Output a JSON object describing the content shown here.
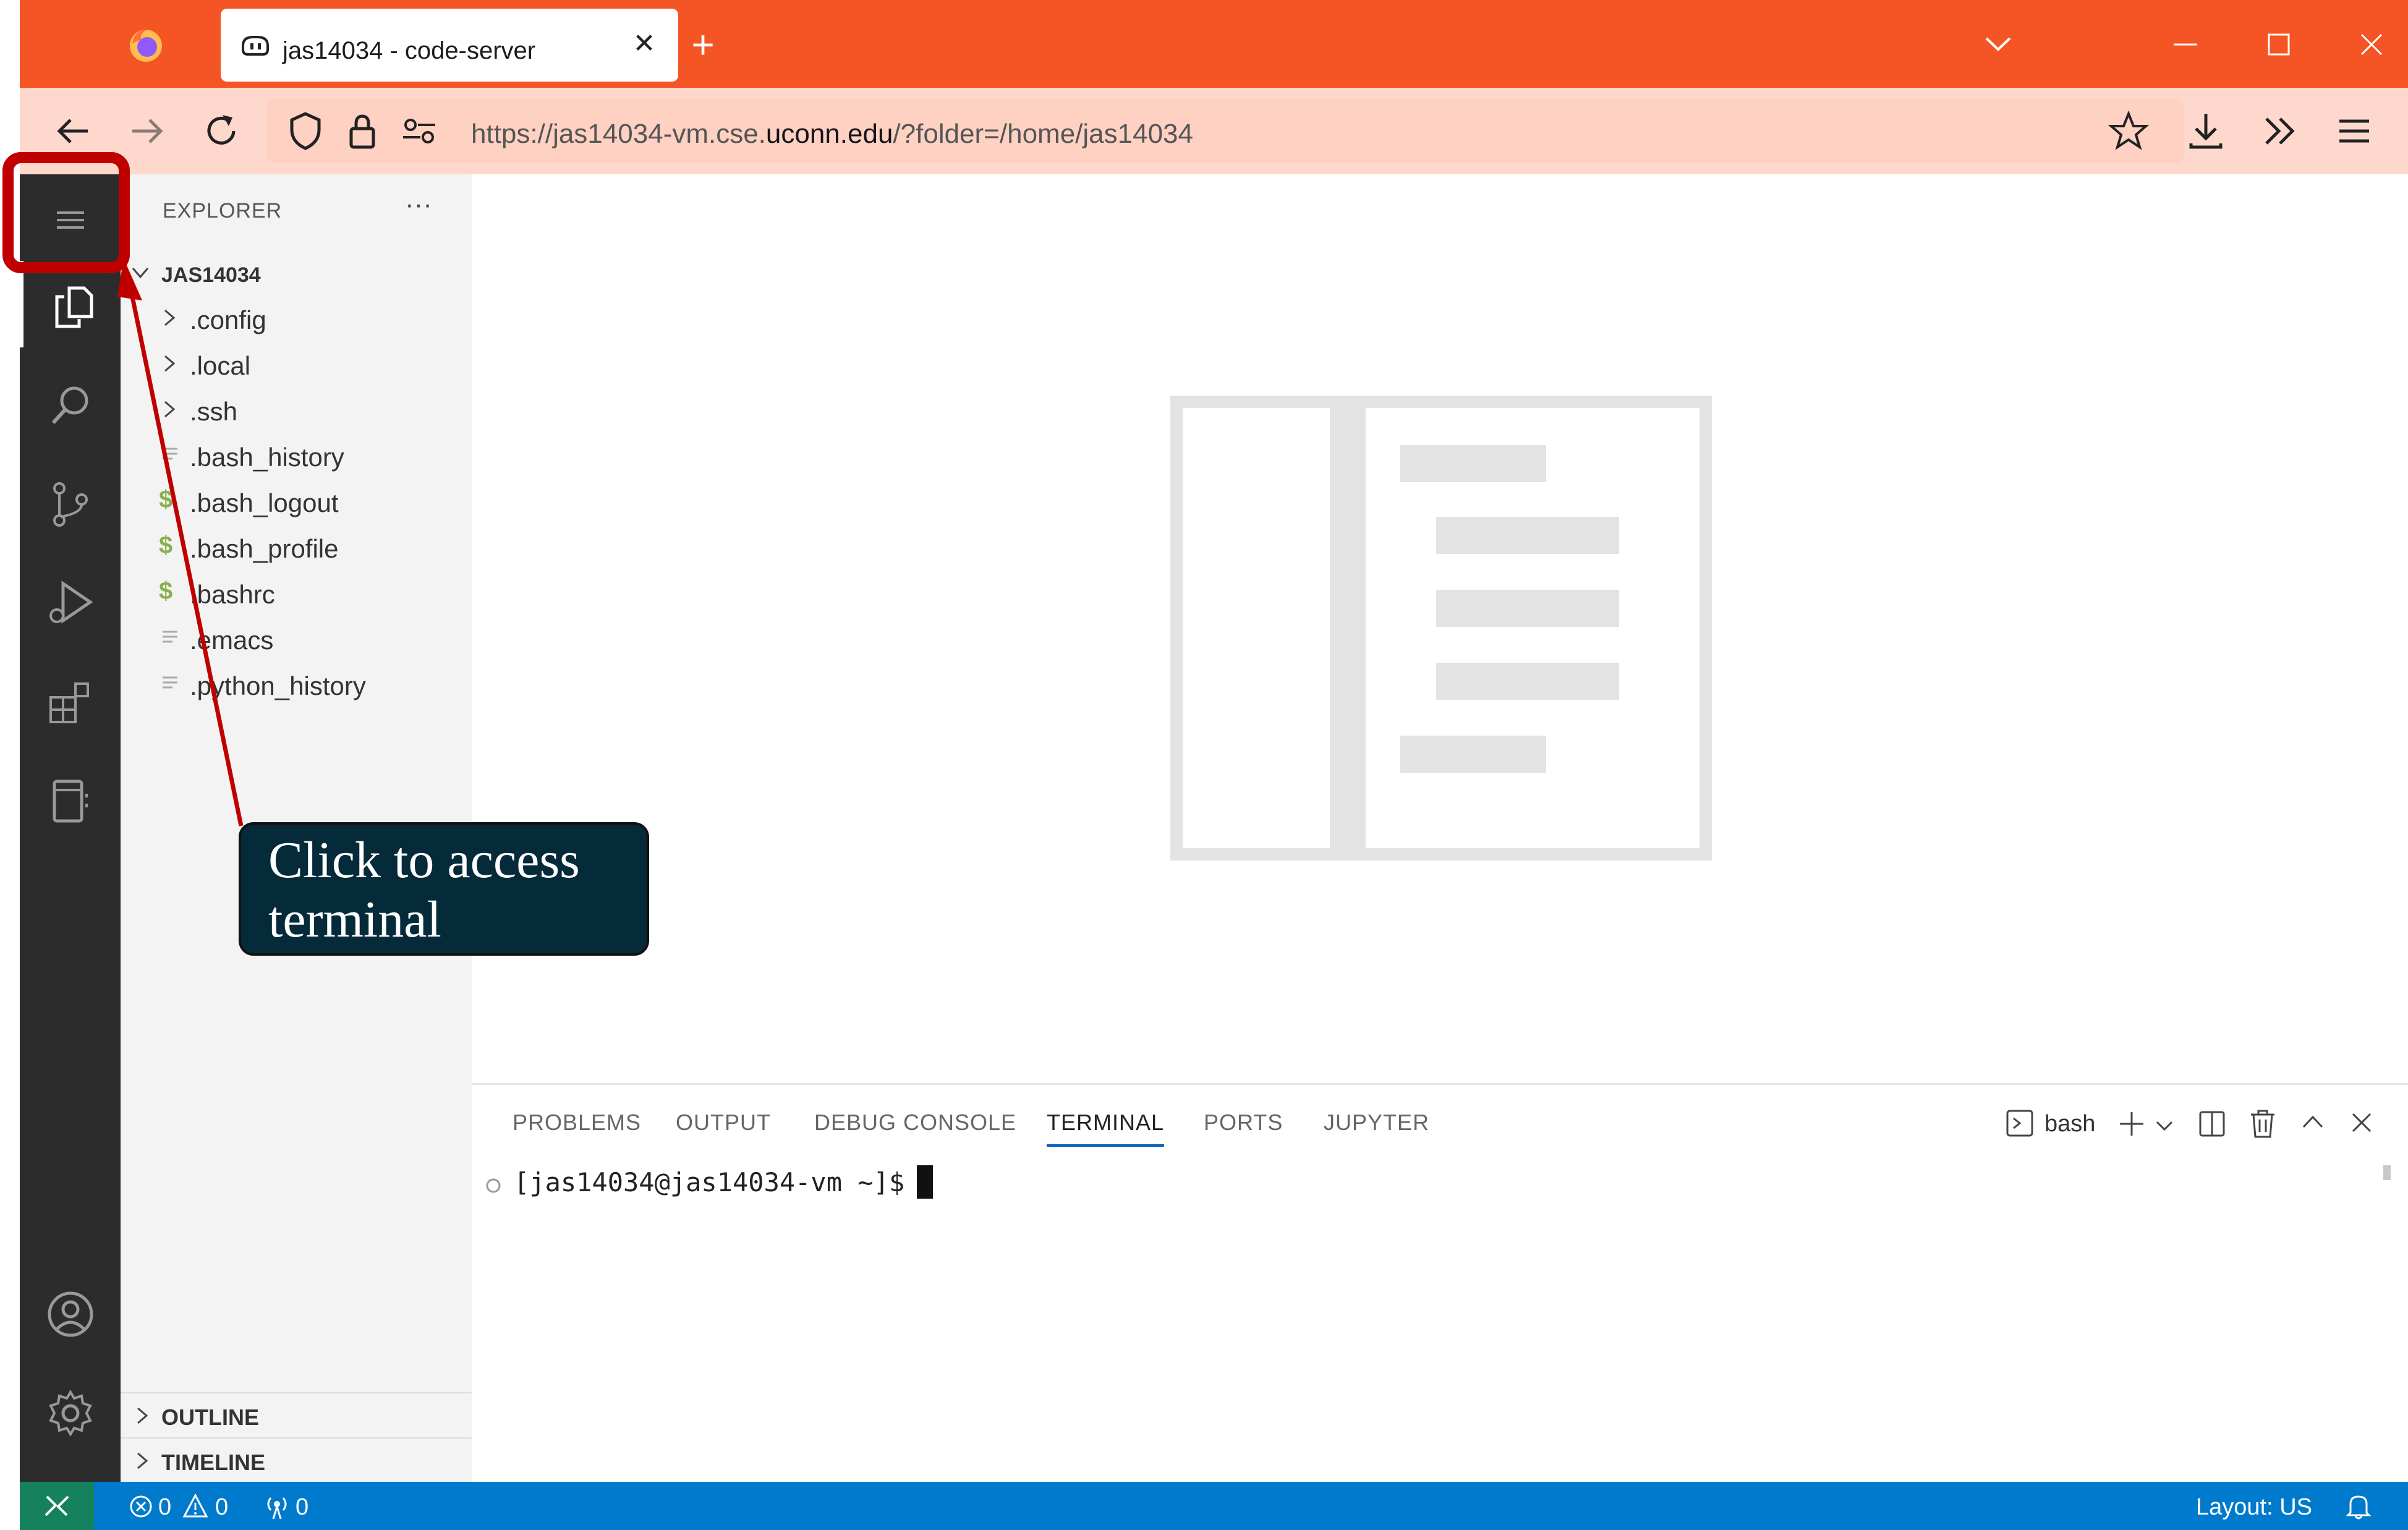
{
  "browser": {
    "tab_title": "jas14034 - code-server",
    "tab_close": "✕",
    "new_tab": "+",
    "url_prefix": "https://jas14034-vm.cse.",
    "url_domain": "uconn.edu",
    "url_suffix": "/?folder=/home/jas14034",
    "accent_color": "#f55424"
  },
  "sidebar": {
    "header": "EXPLORER",
    "more": "···",
    "root_folder": "JAS14034",
    "items": [
      {
        "label": ".config",
        "kind": "folder"
      },
      {
        "label": ".local",
        "kind": "folder"
      },
      {
        "label": ".ssh",
        "kind": "folder"
      },
      {
        "label": ".bash_history",
        "kind": "text"
      },
      {
        "label": ".bash_logout",
        "kind": "shell"
      },
      {
        "label": ".bash_profile",
        "kind": "shell"
      },
      {
        "label": ".bashrc",
        "kind": "shell"
      },
      {
        "label": ".emacs",
        "kind": "text"
      },
      {
        "label": ".python_history",
        "kind": "text"
      }
    ],
    "shell_glyph": "$",
    "sections": [
      "OUTLINE",
      "TIMELINE"
    ]
  },
  "panel": {
    "tabs": [
      "PROBLEMS",
      "OUTPUT",
      "DEBUG CONSOLE",
      "TERMINAL",
      "PORTS",
      "JUPYTER"
    ],
    "active_tab": "TERMINAL",
    "shell_name": "bash",
    "prompt": "[jas14034@jas14034-vm ~]$"
  },
  "statusbar": {
    "errors": "0",
    "warnings": "0",
    "ports": "0",
    "layout": "Layout: US",
    "color": "#007acc"
  },
  "annotation": {
    "callout_line1": "Click to access",
    "callout_line2": "terminal",
    "highlight_color": "#c00000"
  }
}
